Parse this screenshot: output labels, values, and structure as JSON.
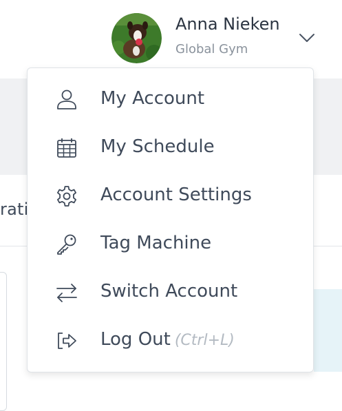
{
  "background": {
    "partial_text": "rati"
  },
  "user": {
    "name": "Anna Nieken",
    "organization": "Global Gym",
    "avatar_icon": "dog-avatar-photo",
    "menu_toggle_icon": "chevron-down-icon"
  },
  "menu": {
    "items": [
      {
        "label": "My Account",
        "icon": "user-icon"
      },
      {
        "label": "My Schedule",
        "icon": "calendar-icon"
      },
      {
        "label": "Account Settings",
        "icon": "gear-icon"
      },
      {
        "label": "Tag Machine",
        "icon": "key-icon"
      },
      {
        "label": "Switch Account",
        "icon": "switch-arrows-icon"
      },
      {
        "label": "Log Out",
        "icon": "logout-icon",
        "shortcut": "(Ctrl+L)"
      }
    ]
  },
  "colors": {
    "text": "#3f4a5a",
    "subtle_text": "#8a929c",
    "shortcut_text": "#b3bac2",
    "background_band": "#f0f1f3",
    "accent_blue": "#e6f3f8"
  }
}
